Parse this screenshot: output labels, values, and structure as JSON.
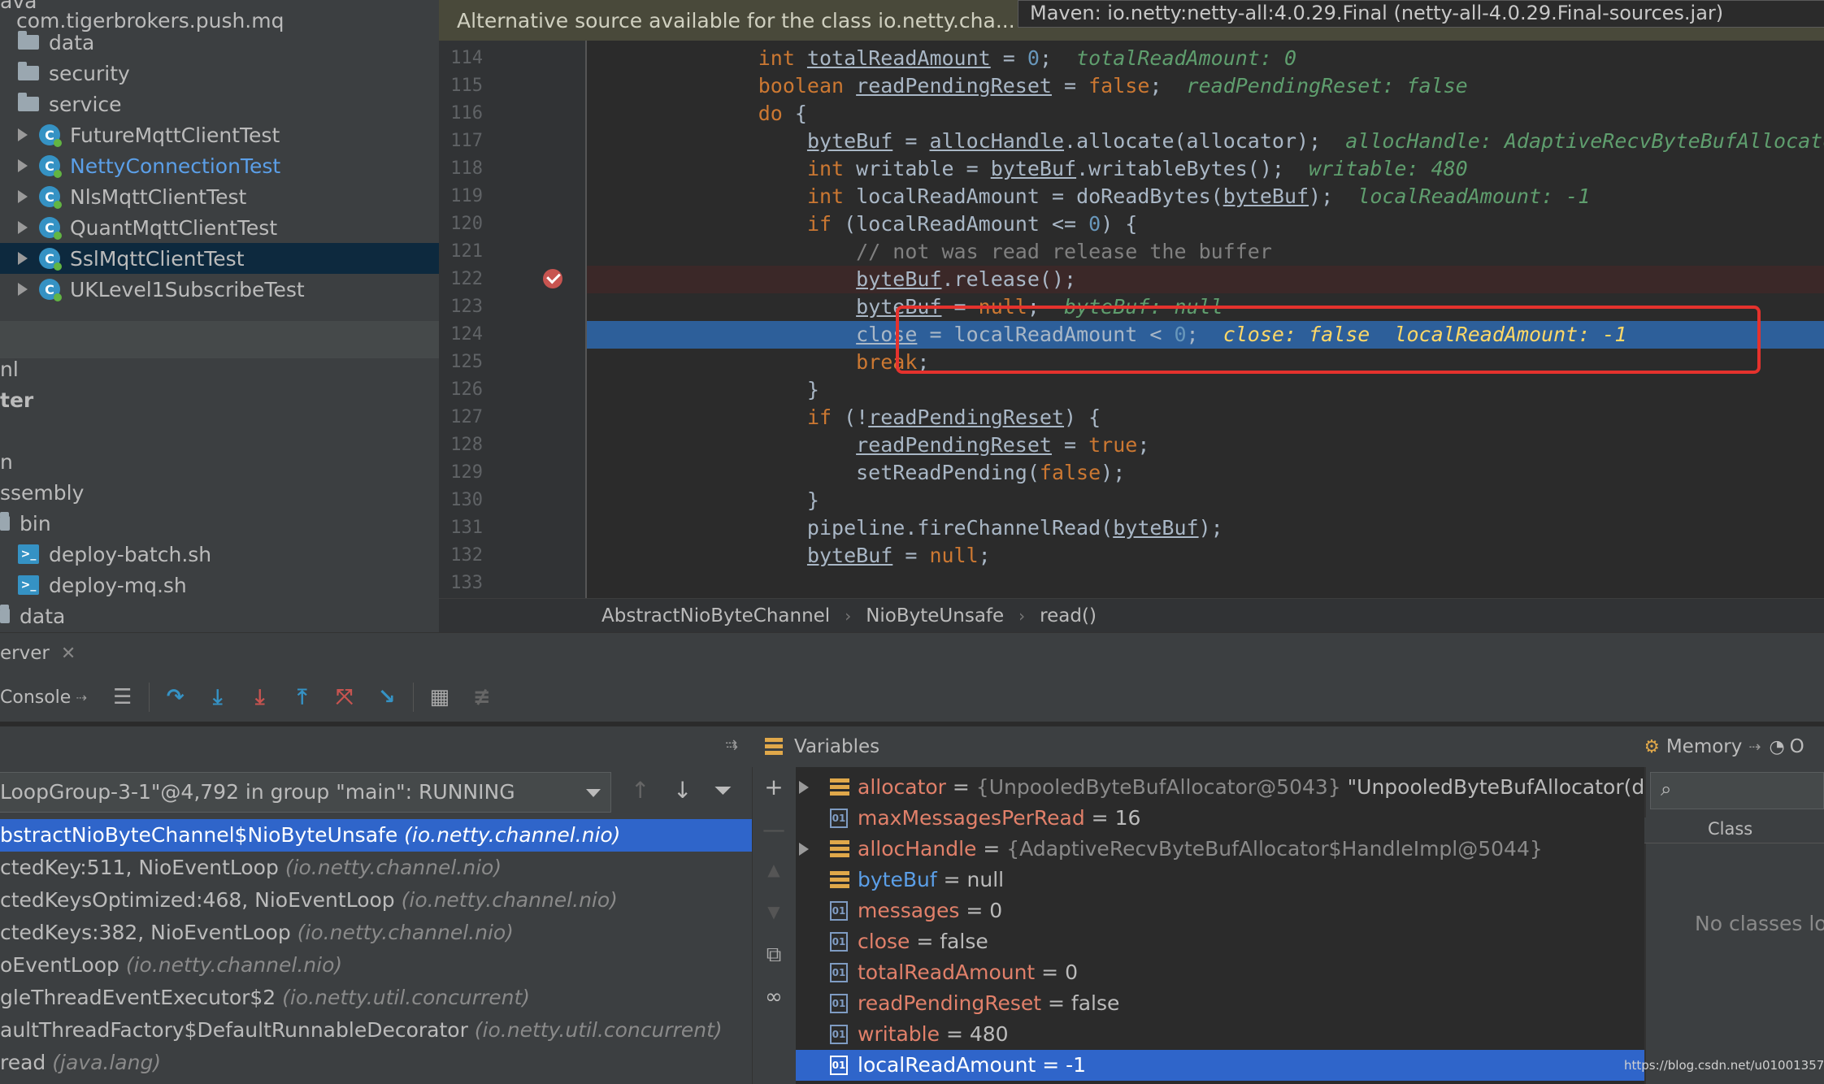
{
  "project_tree": {
    "items": [
      {
        "label": "ava",
        "type": "folder-cut"
      },
      {
        "label": "com.tigerbrokers.push.mq",
        "type": "package"
      },
      {
        "label": "data",
        "type": "folder"
      },
      {
        "label": "security",
        "type": "folder"
      },
      {
        "label": "service",
        "type": "folder"
      },
      {
        "label": "FutureMqttClientTest",
        "type": "class"
      },
      {
        "label": "NettyConnectionTest",
        "type": "class"
      },
      {
        "label": "NlsMqttClientTest",
        "type": "class"
      },
      {
        "label": "QuantMqttClientTest",
        "type": "class"
      },
      {
        "label": "SslMqttClientTest",
        "type": "class"
      },
      {
        "label": "UKLevel1SubscribeTest",
        "type": "class"
      },
      {
        "label": "nl",
        "type": "text"
      },
      {
        "label": "ter",
        "type": "text-bold"
      },
      {
        "label": "n",
        "type": "text"
      },
      {
        "label": "ssembly",
        "type": "text"
      },
      {
        "label": "bin",
        "type": "folder"
      },
      {
        "label": "deploy-batch.sh",
        "type": "script"
      },
      {
        "label": "deploy-mq.sh",
        "type": "script"
      },
      {
        "label": "data",
        "type": "folder"
      }
    ]
  },
  "editor": {
    "banner": "Alternative source available for the class io.netty.cha...",
    "maven_source": "Maven: io.netty:netty-all:4.0.29.Final (netty-all-4.0.29.Final-sources.jar)",
    "line_numbers": [
      "114",
      "115",
      "116",
      "117",
      "118",
      "119",
      "120",
      "121",
      "122",
      "123",
      "124",
      "125",
      "126",
      "127",
      "128",
      "129",
      "130",
      "131",
      "132",
      "133"
    ],
    "breadcrumb": [
      "AbstractNioByteChannel",
      "NioByteUnsafe",
      "read()"
    ]
  },
  "debug": {
    "tab_label": "erver",
    "console_label": "Console",
    "thread": "LoopGroup-3-1\"@4,792 in group \"main\": RUNNING",
    "frames": [
      {
        "method": "bstractNioByteChannel$NioByteUnsafe",
        "pkg": "(io.netty.channel.nio)"
      },
      {
        "method": "ctedKey:511, NioEventLoop",
        "pkg": "(io.netty.channel.nio)"
      },
      {
        "method": "ctedKeysOptimized:468, NioEventLoop",
        "pkg": "(io.netty.channel.nio)"
      },
      {
        "method": "ctedKeys:382, NioEventLoop",
        "pkg": "(io.netty.channel.nio)"
      },
      {
        "method": "oEventLoop",
        "pkg": "(io.netty.channel.nio)"
      },
      {
        "method": "gleThreadEventExecutor$2",
        "pkg": "(io.netty.util.concurrent)"
      },
      {
        "method": "aultThreadFactory$DefaultRunnableDecorator",
        "pkg": "(io.netty.util.concurrent)"
      },
      {
        "method": "read",
        "pkg": "(java.lang)"
      }
    ],
    "variables_title": "Variables",
    "variables": [
      {
        "name": "allocator",
        "value": "{UnpooledByteBufAllocator@5043}",
        "extra": "\"UnpooledByteBufAllocator(dir",
        "kind": "object",
        "expandable": true
      },
      {
        "name": "maxMessagesPerRead",
        "value": "16",
        "kind": "primitive"
      },
      {
        "name": "allocHandle",
        "value": "{AdaptiveRecvByteBufAllocator$HandleImpl@5044}",
        "kind": "object",
        "expandable": true
      },
      {
        "name": "byteBuf",
        "value": "null",
        "kind": "object"
      },
      {
        "name": "messages",
        "value": "0",
        "kind": "primitive"
      },
      {
        "name": "close",
        "value": "false",
        "kind": "primitive"
      },
      {
        "name": "totalReadAmount",
        "value": "0",
        "kind": "primitive"
      },
      {
        "name": "readPendingReset",
        "value": "false",
        "kind": "primitive"
      },
      {
        "name": "writable",
        "value": "480",
        "kind": "primitive"
      },
      {
        "name": "localReadAmount",
        "value": "-1",
        "kind": "primitive"
      }
    ],
    "memory_title": "Memory",
    "memory_extra": "O",
    "memory_class_col": "Class",
    "memory_empty": "No classes lo"
  },
  "watermark": "https://blog.csdn.net/u010013573",
  "colors": {
    "keyword": "#cc7832",
    "number": "#6897bb",
    "selection": "#2f65ca",
    "highlight_box": "#e5322d",
    "variable_name": "#e1806a"
  }
}
